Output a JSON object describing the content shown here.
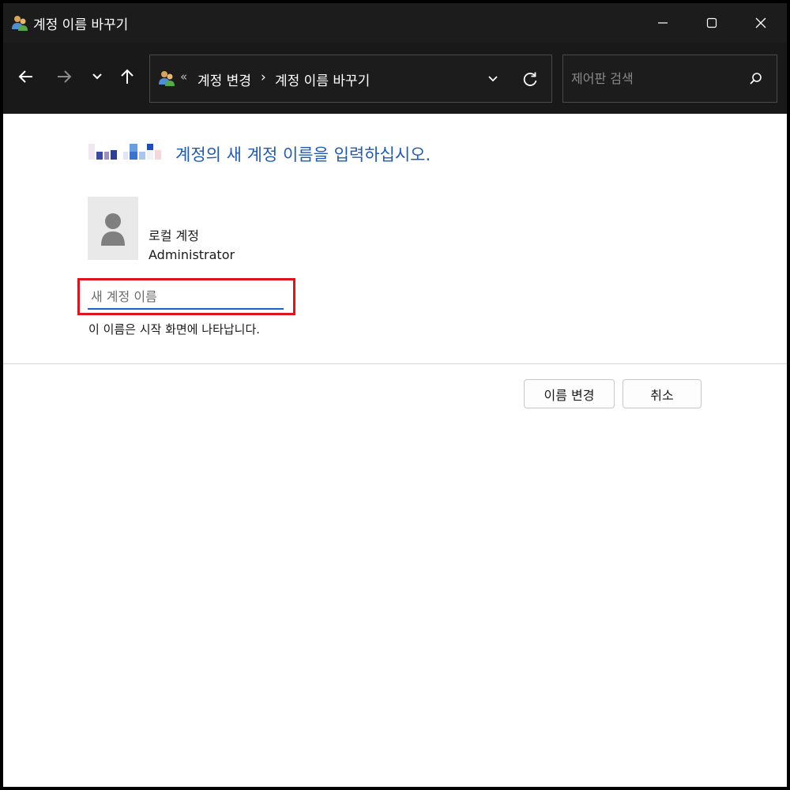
{
  "window": {
    "title": "계정 이름 바꾸기",
    "icon": "users-icon",
    "controls": {
      "minimize": "minimize-icon",
      "maximize": "maximize-icon",
      "close": "close-icon"
    }
  },
  "navbar": {
    "address": {
      "separator": "«",
      "crumbs": [
        "계정 변경",
        "계정 이름 바꾸기"
      ],
      "crumb_separator": "›"
    },
    "search": {
      "placeholder": "제어판 검색"
    }
  },
  "content": {
    "heading": "계정의 새 계정 이름을 입력하십시오.",
    "account": {
      "name": "로컬 계정",
      "role": "Administrator"
    },
    "new_name_input": {
      "value": "",
      "placeholder": "새 계정 이름"
    },
    "hint": "이 이름은 시작 화면에 나타납니다.",
    "buttons": {
      "rename": "이름 변경",
      "cancel": "취소"
    }
  },
  "colors": {
    "heading": "#1e5bb8",
    "highlight": "#e0141e",
    "input_underline": "#1a64c8",
    "titlebar": "#1c1c1c"
  }
}
